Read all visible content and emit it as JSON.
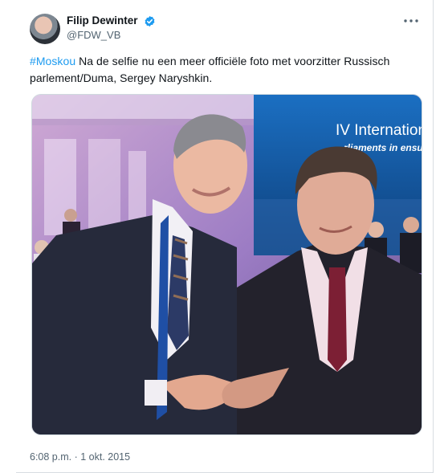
{
  "tweet": {
    "display_name": "Filip Dewinter",
    "handle": "@FDW_VB",
    "verified_icon": "verified-badge-icon",
    "more_icon": "more-options-icon",
    "hashtag": "#Moskou",
    "text": " Na de selfie nu een meer officiële foto met voorzitter Russisch parlement/Duma, Sergey Naryshkin.",
    "timestamp": "6:08 p.m. · 1 okt. 2015",
    "photo_banner_line1": "IV International Par",
    "photo_banner_line2": "rliaments in ensurin"
  },
  "colors": {
    "accent": "#1d9bf0",
    "secondary_text": "#536471",
    "primary_text": "#0f1419"
  }
}
